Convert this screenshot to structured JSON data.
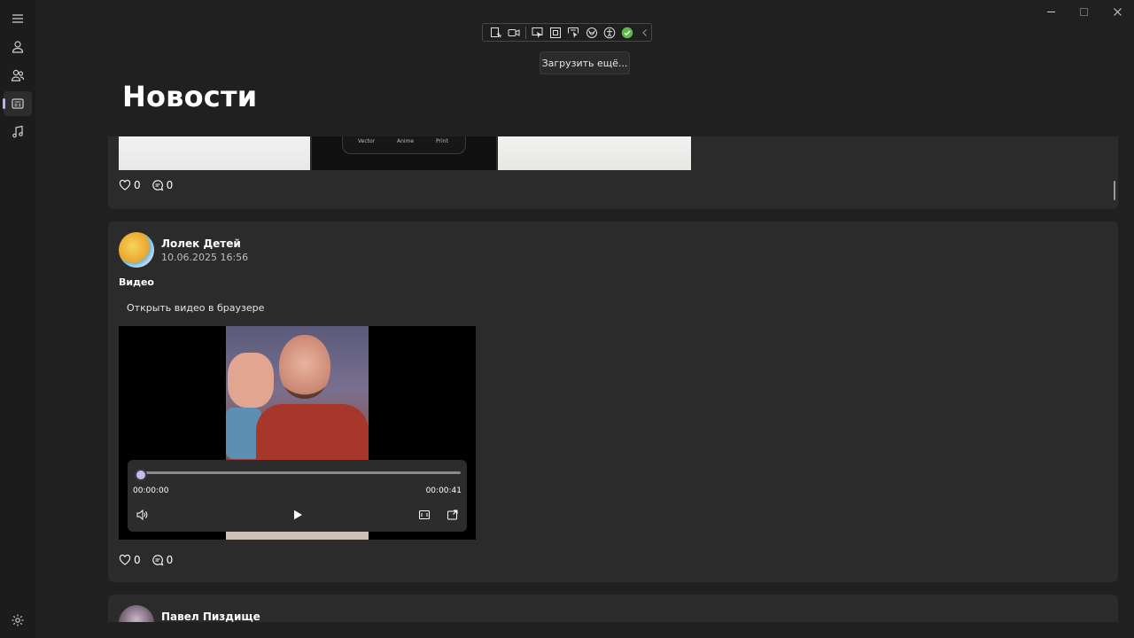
{
  "window": {
    "controls": [
      "minimize",
      "maximize",
      "close"
    ]
  },
  "nav": {
    "items": [
      {
        "icon": "hamburger-icon"
      },
      {
        "icon": "person-icon"
      },
      {
        "icon": "people-icon"
      },
      {
        "icon": "news-icon",
        "active": true
      },
      {
        "icon": "music-icon"
      }
    ],
    "settings_icon": "gear-icon"
  },
  "toolbar": {
    "icons": [
      "edit-select-icon",
      "camera-icon",
      "pointer-icon",
      "frame-icon",
      "element-select-icon",
      "layout-icon",
      "accessibility-icon",
      "check-icon",
      "chevron-left-icon"
    ],
    "tooltip": "Загрузить ещё..."
  },
  "page": {
    "title": "Новости"
  },
  "posts": [
    {
      "images": {
        "labels": [
          "Vector",
          "Anime",
          "Print"
        ]
      },
      "likes": "0",
      "comments": "0"
    },
    {
      "author": "Лолек Детей",
      "date": "10.06.2025 16:56",
      "title": "Видео",
      "open_video_label": "Открыть видео в браузере",
      "video": {
        "current_time": "00:00:00",
        "duration": "00:00:41",
        "progress": 0
      },
      "likes": "0",
      "comments": "0"
    },
    {
      "author": "Павел Пиздище"
    }
  ],
  "colors": {
    "background": "#202020",
    "card": "#2b2b2b",
    "accent": "#b6b0f0"
  }
}
